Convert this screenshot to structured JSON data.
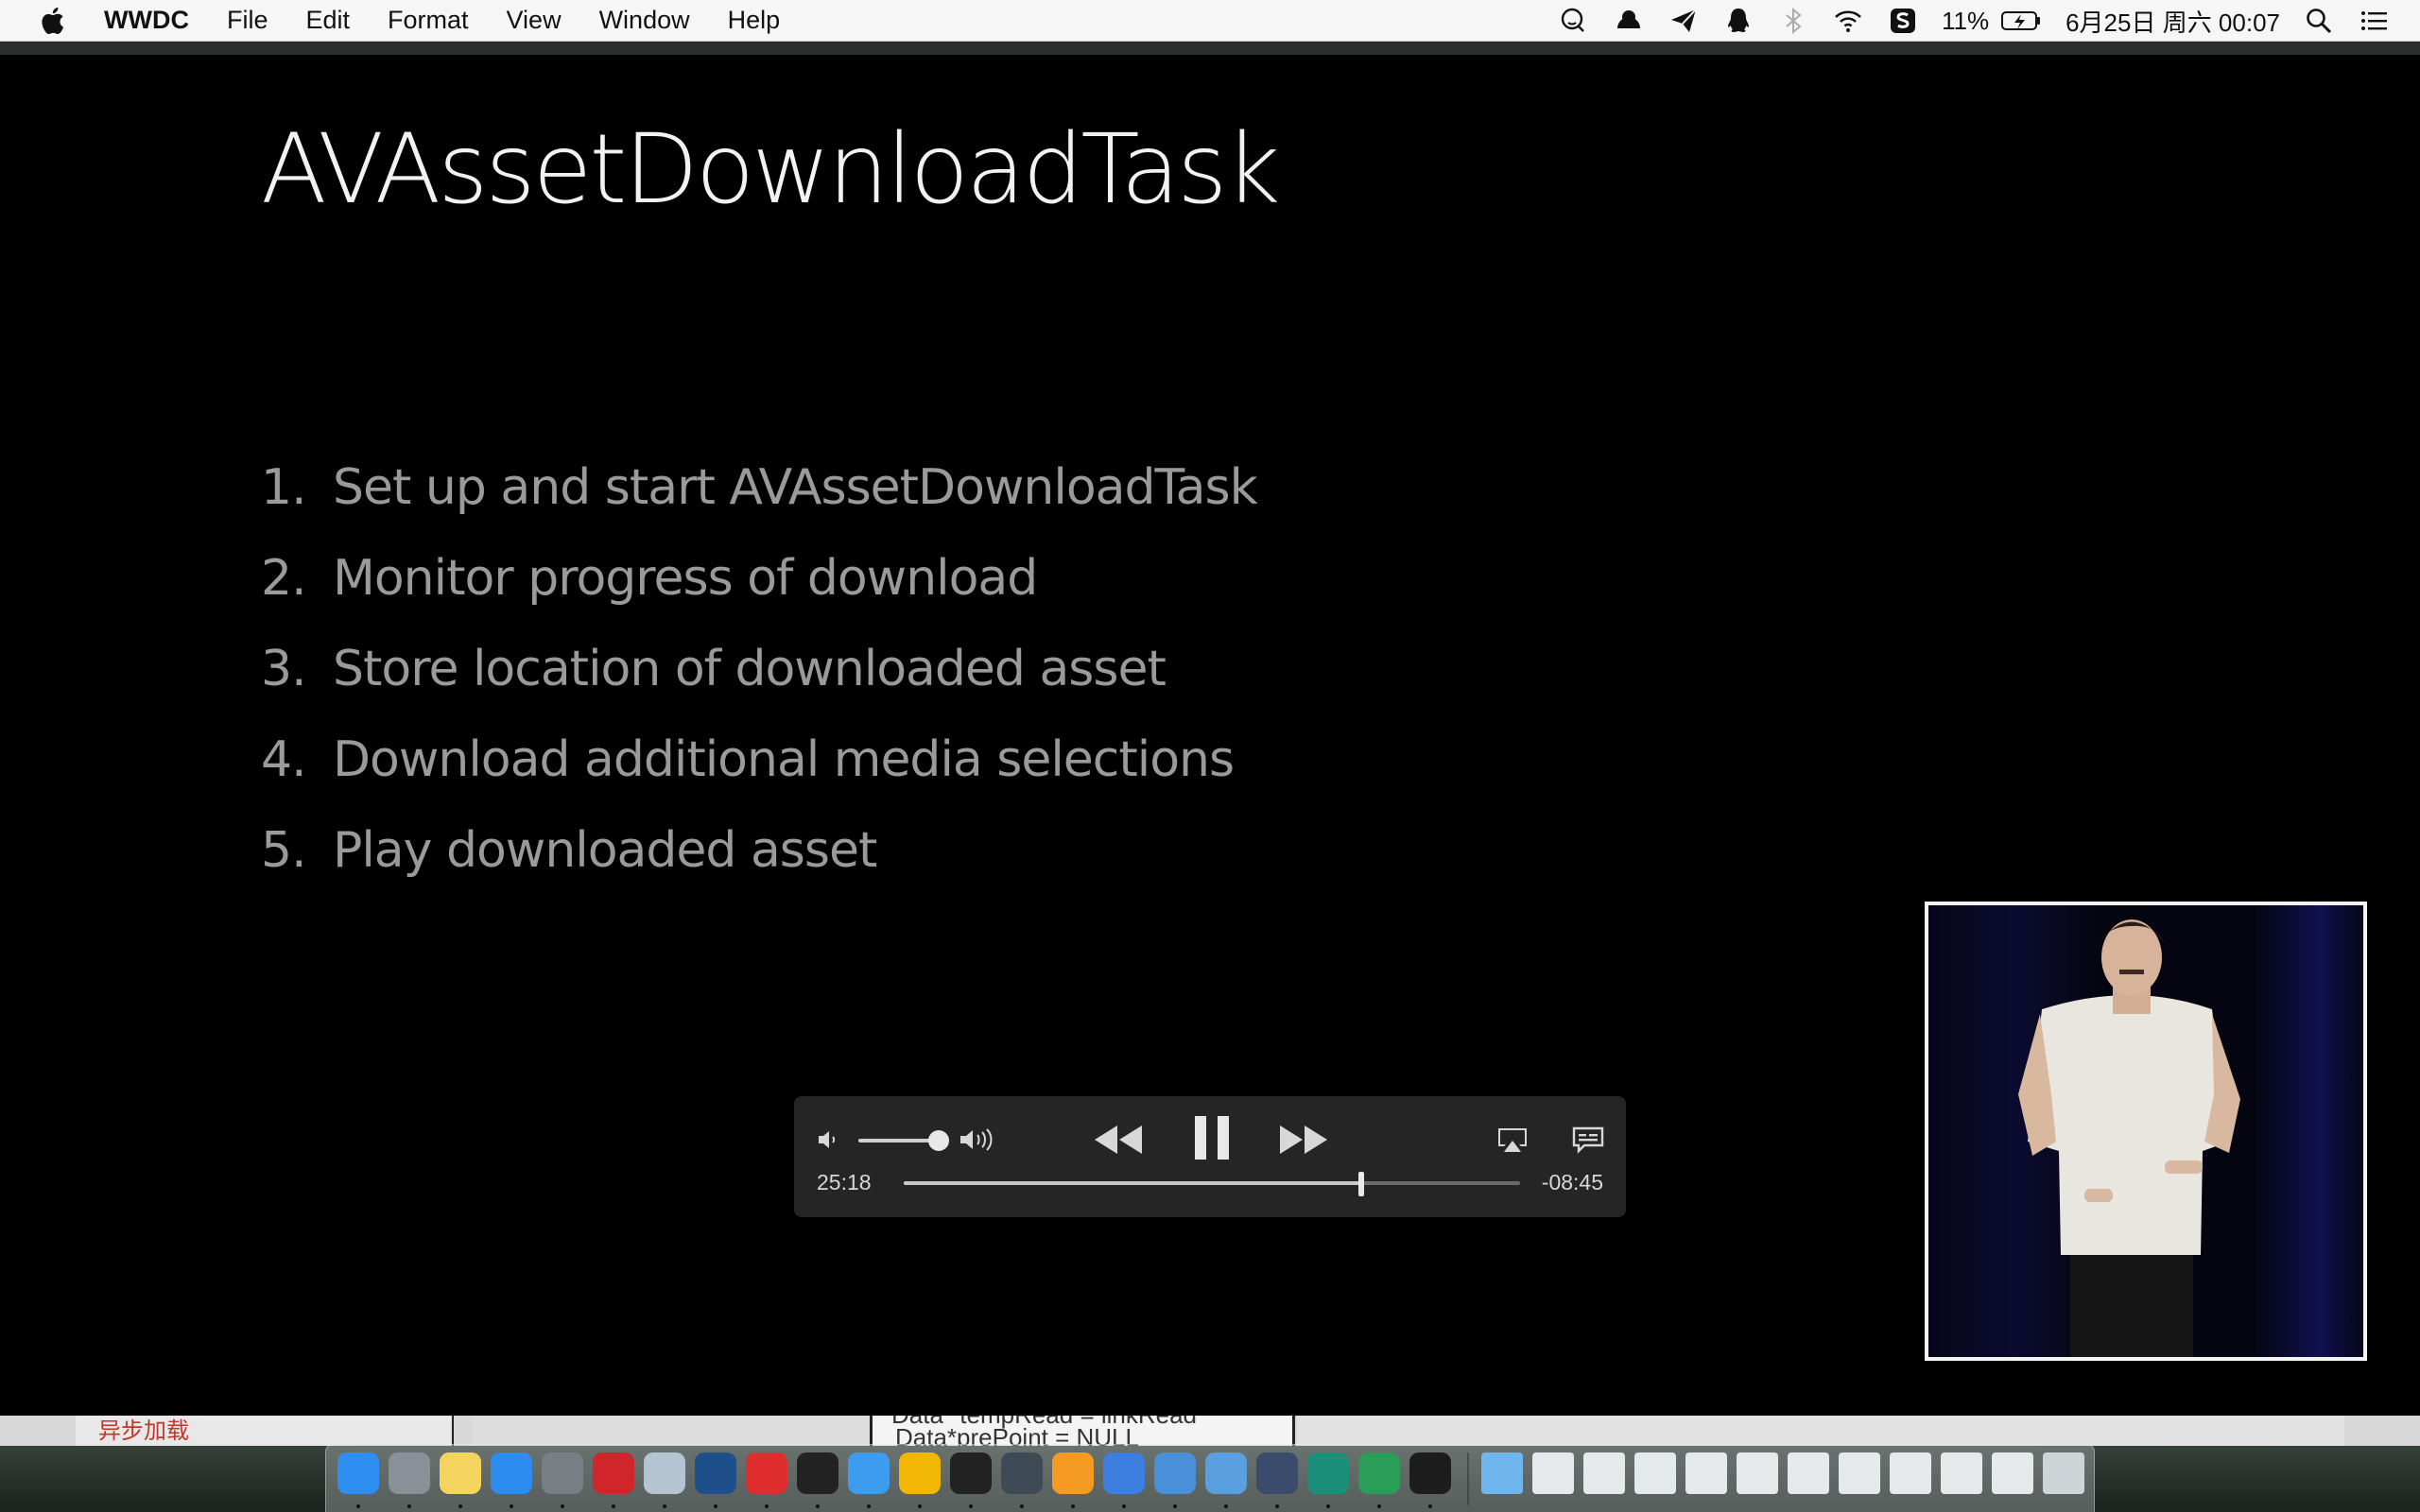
{
  "menubar": {
    "app_name": "WWDC",
    "items": [
      "File",
      "Edit",
      "Format",
      "View",
      "Window",
      "Help"
    ],
    "status": {
      "battery": "11%",
      "datetime": "6月25日 周六  00:07"
    }
  },
  "slide": {
    "title": "AVAssetDownloadTask",
    "items": [
      {
        "num": "1.",
        "text": "Set up and start AVAssetDownloadTask"
      },
      {
        "num": "2.",
        "text": "Monitor progress of download"
      },
      {
        "num": "3.",
        "text": "Store location of downloaded asset"
      },
      {
        "num": "4.",
        "text": "Download additional media selections"
      },
      {
        "num": "5.",
        "text": "Play downloaded asset"
      }
    ]
  },
  "player": {
    "elapsed": "25:18",
    "remaining": "-08:45",
    "progress": 0.743,
    "volume": 0.85,
    "state": "playing"
  },
  "background": {
    "label_async": "异步加载",
    "code_line1": "Data *tempRead = linkRead",
    "code_line2": "Data*prePoint = NULL"
  },
  "dock": {
    "apps": [
      "finder-icon",
      "launchpad-icon",
      "notes-icon",
      "app-store-icon",
      "system-preferences-icon",
      "youdao-icon",
      "preview-icon",
      "instruments-icon",
      "gitkraken-icon",
      "terminal-icon",
      "safari-icon",
      "chrome-icon",
      "qq-icon",
      "monitor-icon",
      "ibooks-icon",
      "keynote-icon",
      "xcode-icon",
      "tools-icon",
      "wwdc-icon",
      "webstorm-icon",
      "pycharm-icon",
      "activity-monitor-icon"
    ],
    "colors": [
      "#2f8ff0",
      "#8a8f98",
      "#f4d35e",
      "#2d8cf0",
      "#7a7f86",
      "#d0252b",
      "#b5c4d3",
      "#1f4f8a",
      "#e02d2d",
      "#222222",
      "#3d9cf0",
      "#f2b705",
      "#222222",
      "#3e4a56",
      "#f59b23",
      "#3c7fe0",
      "#4a90d9",
      "#5aa0e0",
      "#3b4b6b",
      "#1b8f7a",
      "#2a9d58",
      "#1d1d1d"
    ]
  }
}
